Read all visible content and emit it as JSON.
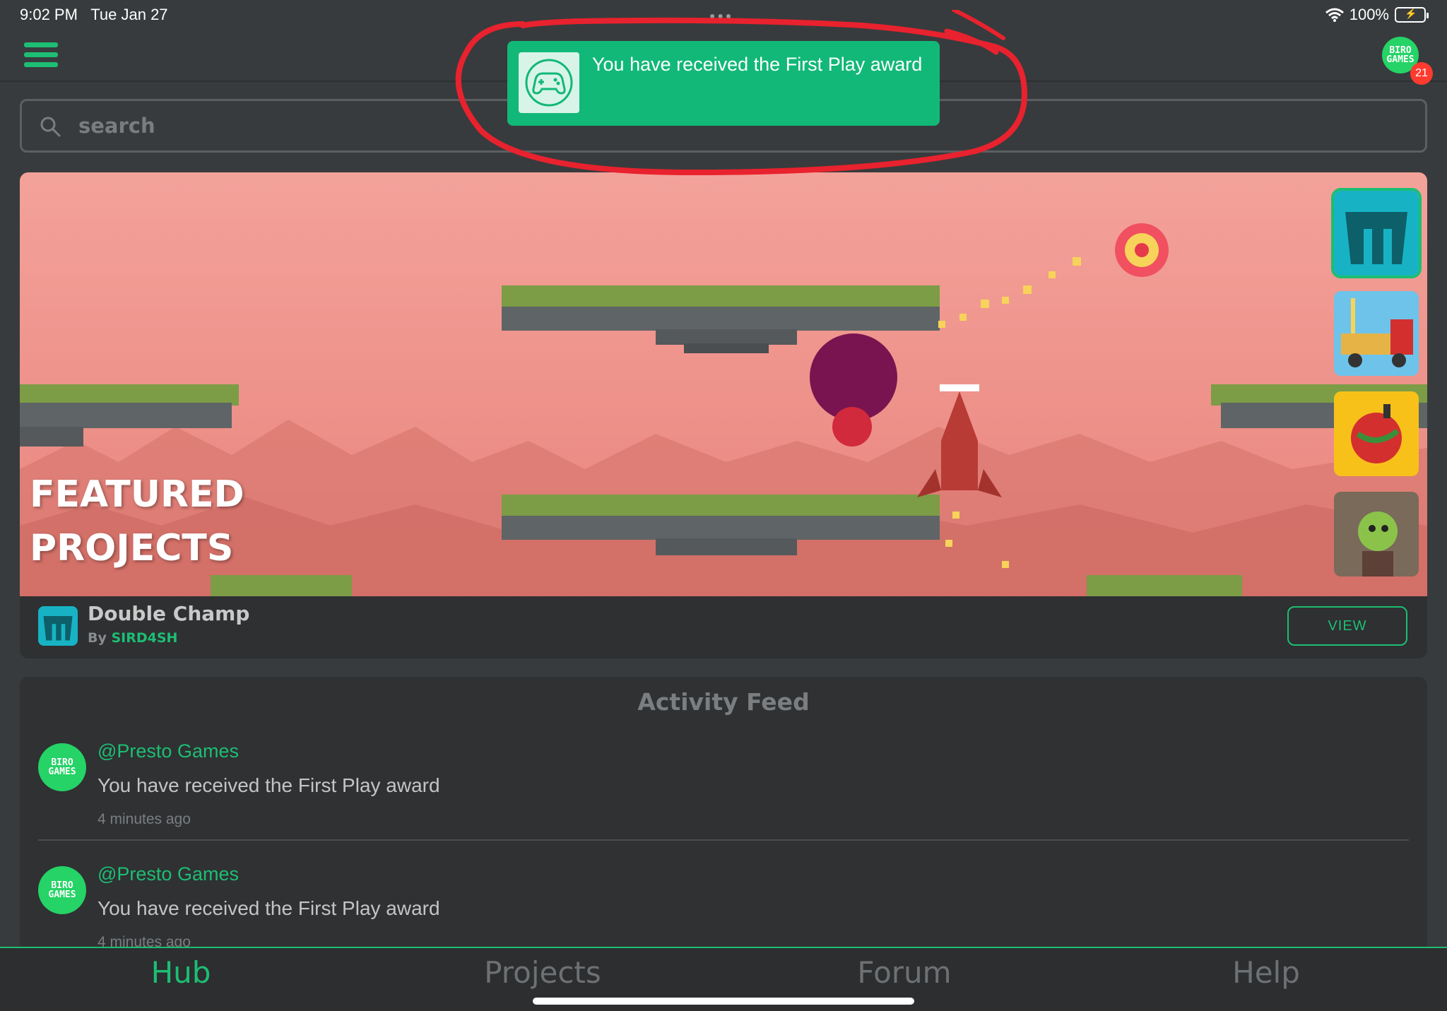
{
  "status_bar": {
    "time": "9:02 PM",
    "date": "Tue Jan 27",
    "battery": "100%"
  },
  "top_bar": {
    "profile_avatar_text": "BIRO GAMES",
    "notification_count": "21",
    "menu_icon": "hamburger-icon"
  },
  "toast": {
    "message": "You have received the First Play award",
    "icon": "gamepad-icon"
  },
  "search": {
    "placeholder": "search"
  },
  "featured": {
    "title_line1": "FEATURED",
    "title_line2": "PROJECTS",
    "project_name": "Double Champ",
    "by_label": "By",
    "author": "SIRD4SH",
    "view_label": "VIEW"
  },
  "activity_feed": {
    "title": "Activity Feed",
    "items": [
      {
        "user": "@Presto Games",
        "text": "You have received the First Play award",
        "time": "4 minutes ago",
        "avatar_text": "BIRO GAMES"
      },
      {
        "user": "@Presto Games",
        "text": "You have received the First Play award",
        "time": "4 minutes ago",
        "avatar_text": "BIRO GAMES"
      }
    ]
  },
  "bottom_nav": {
    "items": [
      "Hub",
      "Projects",
      "Forum",
      "Help"
    ],
    "active": "Hub"
  },
  "colors": {
    "accent": "#1dbe73",
    "toast": "#12b877",
    "background": "#383b3d",
    "badge": "#ff3b30",
    "annotation": "#e8222e"
  }
}
